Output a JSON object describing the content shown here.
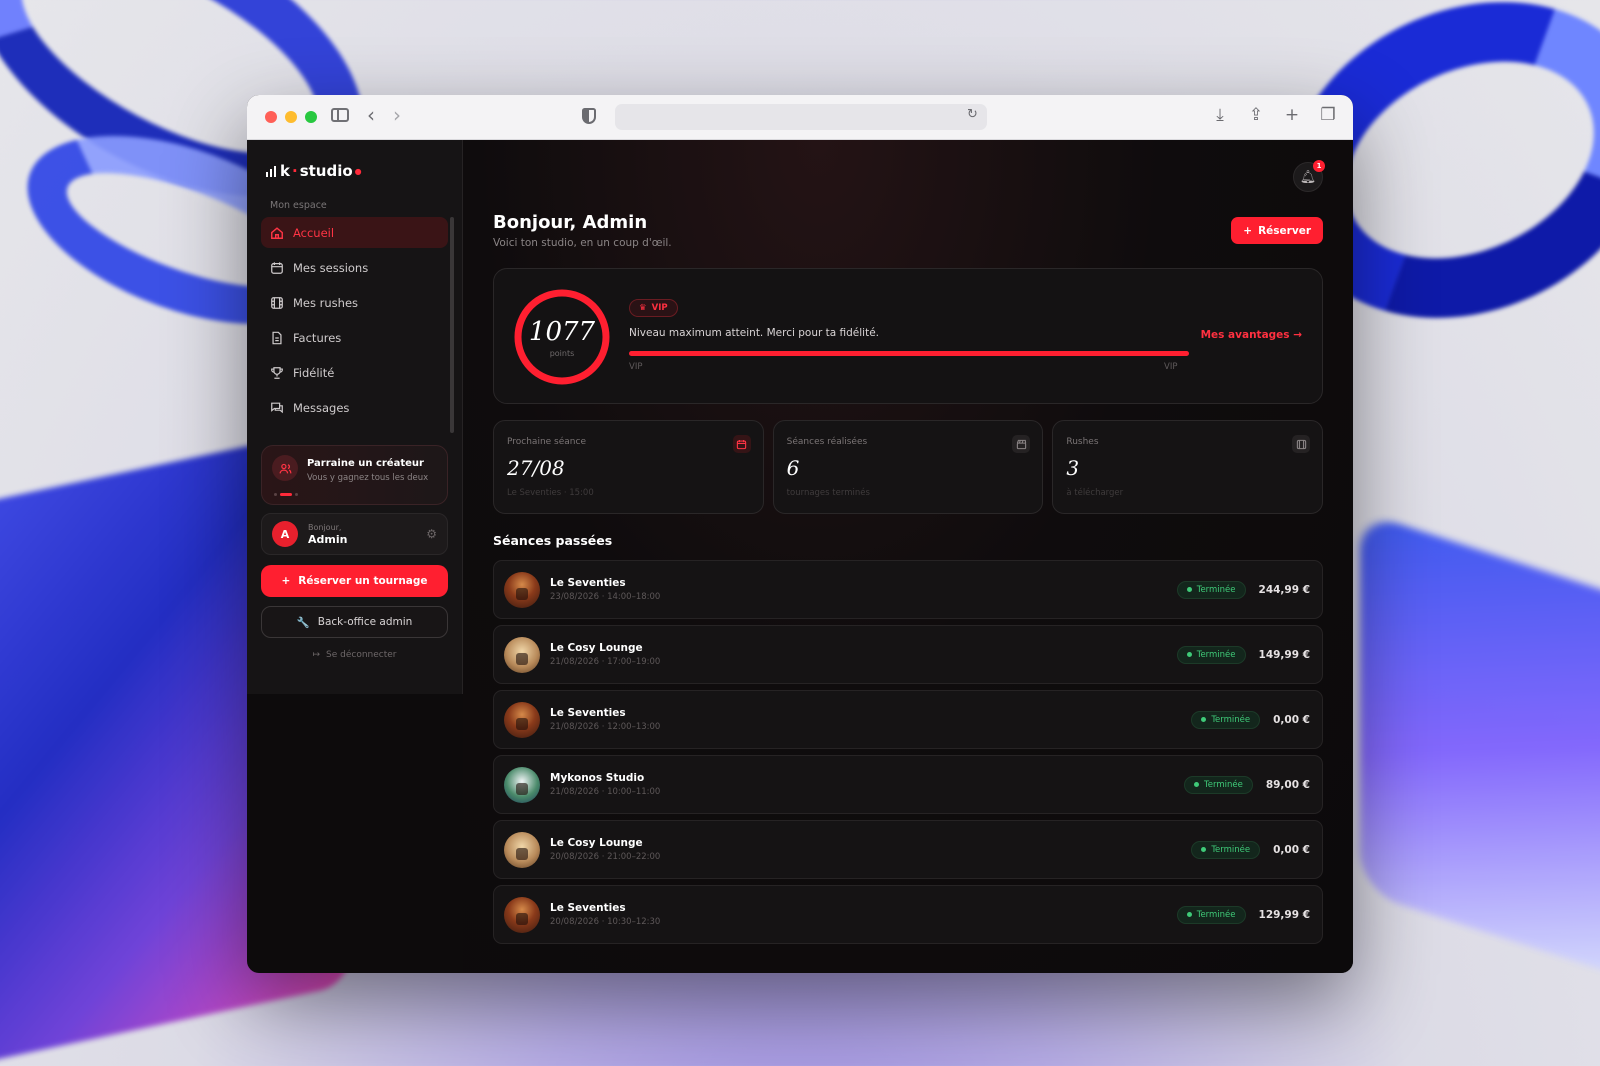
{
  "browser": {
    "address": ""
  },
  "brand": {
    "logo_text": "k studio",
    "logo_letter": "k",
    "logo_word": "studio",
    "accent": "#ff1f30"
  },
  "sidebar": {
    "section_label": "Mon espace",
    "items": [
      {
        "label": "Accueil",
        "icon": "home-icon",
        "active": true
      },
      {
        "label": "Mes sessions",
        "icon": "calendar-icon"
      },
      {
        "label": "Mes rushes",
        "icon": "film-icon"
      },
      {
        "label": "Factures",
        "icon": "document-icon"
      },
      {
        "label": "Fidélité",
        "icon": "trophy-icon"
      },
      {
        "label": "Messages",
        "icon": "chat-icon"
      }
    ],
    "referral": {
      "title": "Parraine un créateur",
      "subtitle": "Vous y gagnez tous les deux"
    },
    "user": {
      "greeting": "Bonjour,",
      "name": "Admin",
      "initial": "A"
    },
    "book_button": "Réserver un tournage",
    "backoffice_button": "Back-office admin",
    "logout": "Se déconnecter"
  },
  "header": {
    "notification_count": "1",
    "title": "Bonjour, Admin",
    "subtitle": "Voici ton studio, en un coup d'œil.",
    "reserve_button": "Réserver"
  },
  "loyalty": {
    "points": "1077",
    "points_unit": "points",
    "progress": 1.0,
    "tier_badge": "VIP",
    "message": "Niveau maximum atteint. Merci pour ta fidélité.",
    "from_tier": "VIP",
    "to_tier": "VIP",
    "advantages_link": "Mes avantages →"
  },
  "stats": [
    {
      "label": "Prochaine séance",
      "value": "27/08",
      "sub": "Le Seventies · 15:00",
      "icon": "calendar-icon"
    },
    {
      "label": "Séances réalisées",
      "value": "6",
      "sub": "tournages terminés",
      "icon": "clapper-icon"
    },
    {
      "label": "Rushes",
      "value": "3",
      "sub": "à télécharger",
      "icon": "film-icon"
    }
  ],
  "past_sessions": {
    "title": "Séances passées",
    "rows": [
      {
        "name": "Le Seventies",
        "time": "23/08/2026 · 14:00–18:00",
        "status": "Terminée",
        "price": "244,99 €",
        "thumb": "warm"
      },
      {
        "name": "Le Cosy Lounge",
        "time": "21/08/2026 · 17:00–19:00",
        "status": "Terminée",
        "price": "149,99 €",
        "thumb": "cosy"
      },
      {
        "name": "Le Seventies",
        "time": "21/08/2026 · 12:00–13:00",
        "status": "Terminée",
        "price": "0,00 €",
        "thumb": "warm"
      },
      {
        "name": "Mykonos Studio",
        "time": "21/08/2026 · 10:00–11:00",
        "status": "Terminée",
        "price": "89,00 €",
        "thumb": "myk"
      },
      {
        "name": "Le Cosy Lounge",
        "time": "20/08/2026 · 21:00–22:00",
        "status": "Terminée",
        "price": "0,00 €",
        "thumb": "cosy"
      },
      {
        "name": "Le Seventies",
        "time": "20/08/2026 · 10:30–12:30",
        "status": "Terminée",
        "price": "129,99 €",
        "thumb": "warm"
      }
    ]
  }
}
